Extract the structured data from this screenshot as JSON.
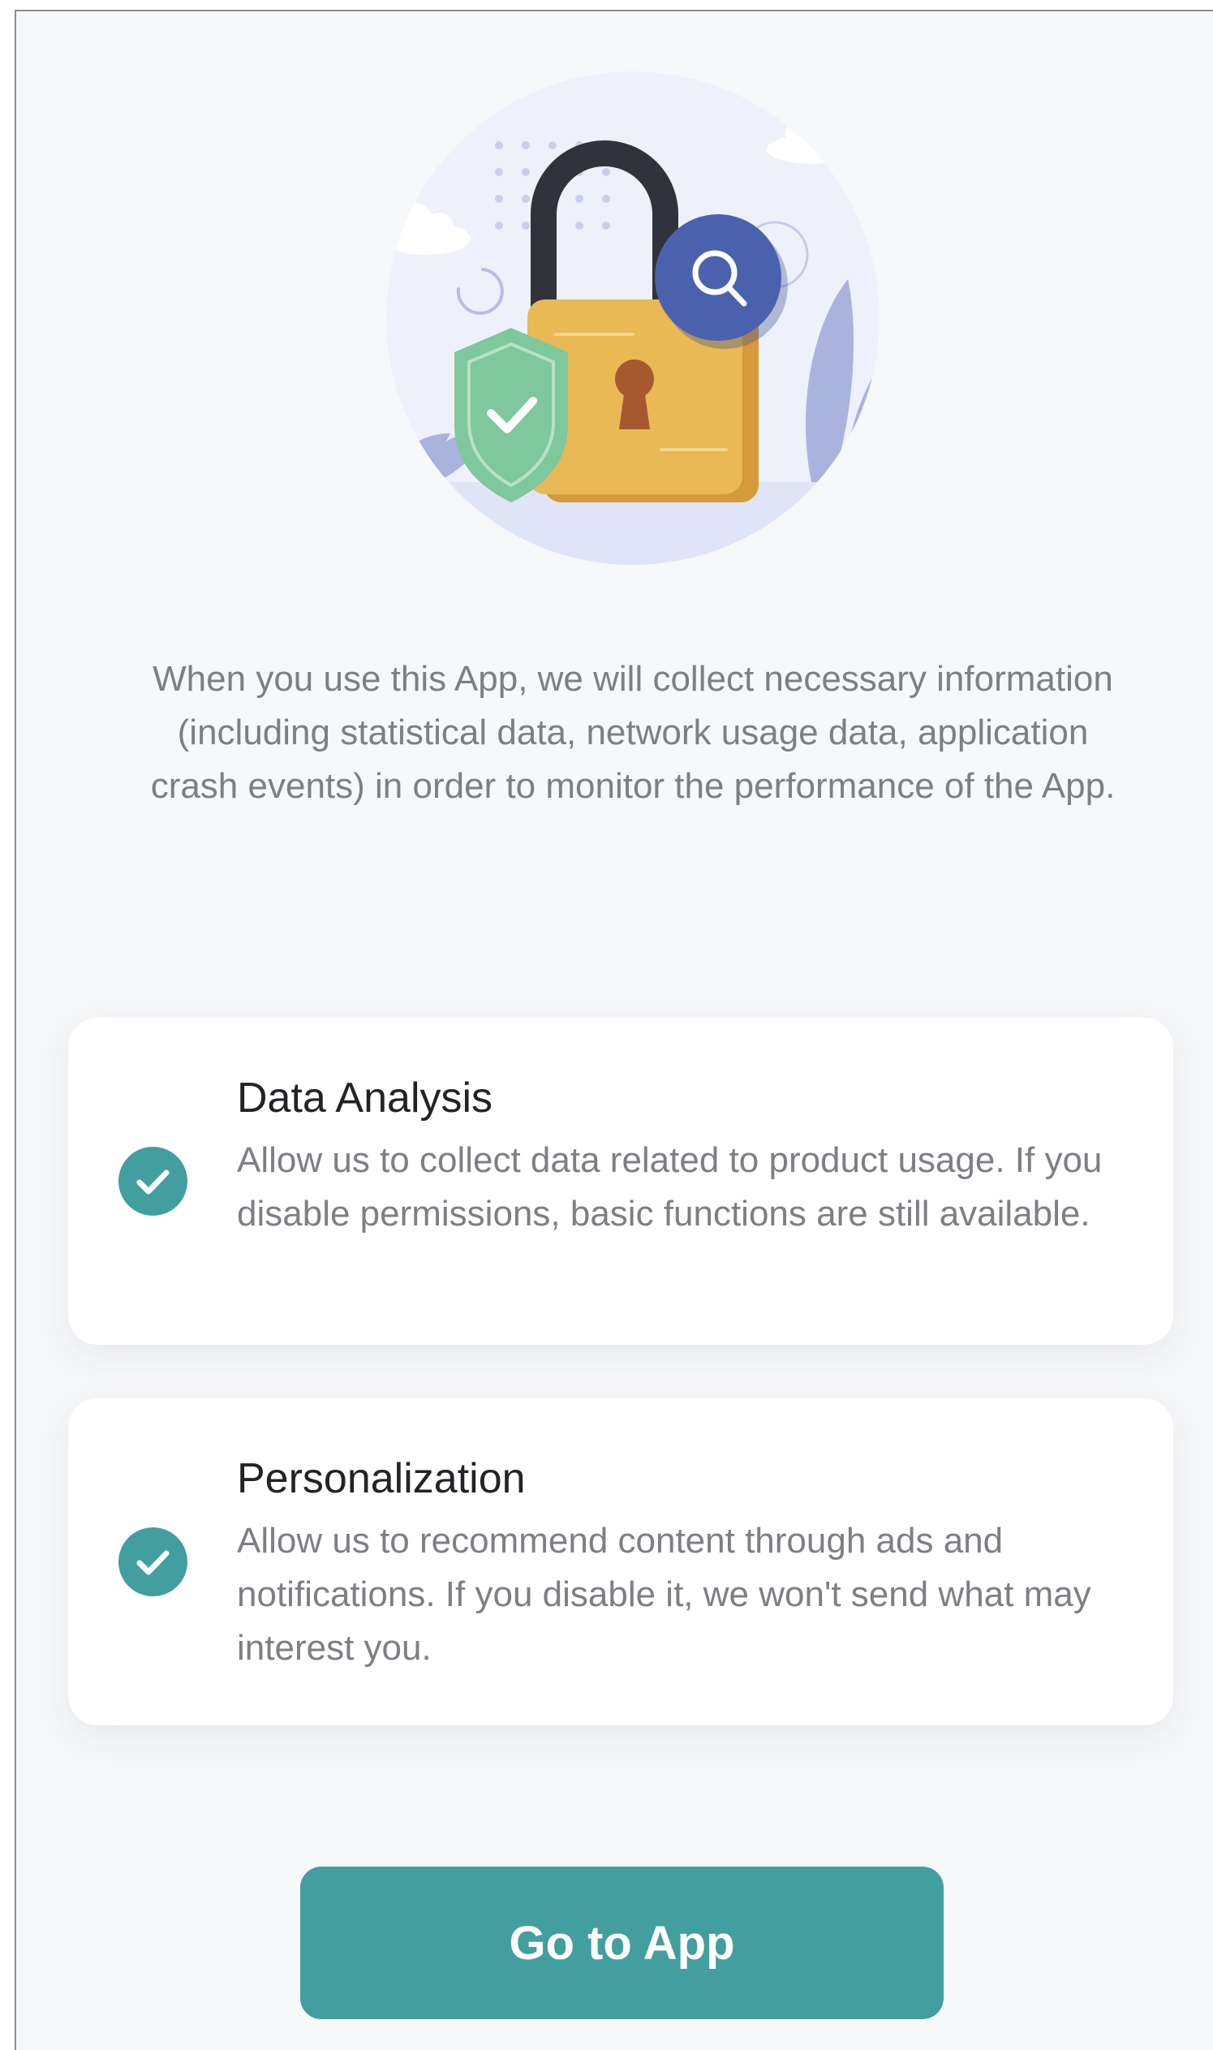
{
  "intro": {
    "text": "When you use this App, we will collect necessary information (including statistical data, network usage data, application crash events) in order to monitor the performance of the App."
  },
  "illustration": {
    "icons": [
      "padlock-icon",
      "search-icon",
      "shield-check-icon",
      "cloud-icon",
      "plant-icon"
    ]
  },
  "options": [
    {
      "title": "Data Analysis",
      "description": "Allow us to collect data related to product usage. If you disable permissions, basic functions are still available.",
      "checked": true
    },
    {
      "title": "Personalization",
      "description": "Allow us to recommend content through ads and notifications. If you disable it, we won't send what may interest you.",
      "checked": true
    }
  ],
  "button": {
    "label": "Go to App"
  },
  "colors": {
    "accent": "#429e9f",
    "background": "#f7f8fa",
    "lock_body": "#e8b955",
    "lock_shackle": "#30333b",
    "search_badge": "#4a62ad",
    "shield": "#7fc79d"
  }
}
